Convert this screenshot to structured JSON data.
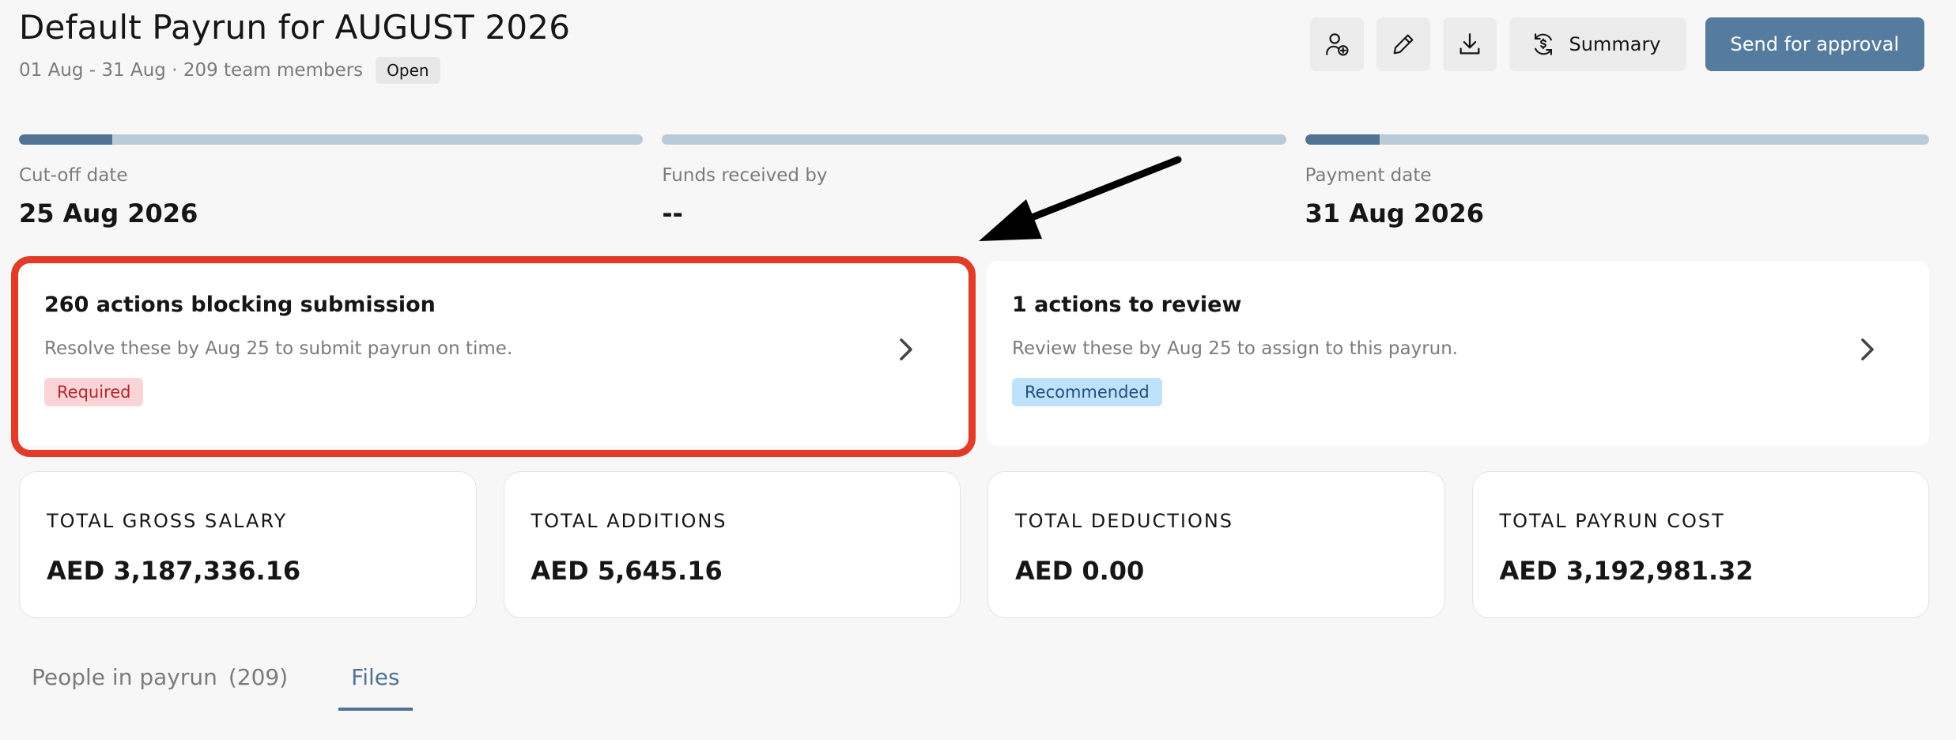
{
  "header": {
    "title": "Default Payrun for AUGUST 2026",
    "meta": "01 Aug - 31 Aug · 209 team members",
    "status": "Open"
  },
  "toolbar": {
    "icons": [
      "add-person-icon",
      "pencil-icon",
      "download-icon",
      "summary-icon"
    ],
    "summary_label": "Summary",
    "approval_label": "Send for approval",
    "accent_color": "#557c9e"
  },
  "steps": [
    {
      "label": "Cut-off date",
      "value": "25 Aug 2026",
      "progress": 0.15
    },
    {
      "label": "Funds received by",
      "value": "--",
      "progress": 0
    },
    {
      "label": "Payment date",
      "value": "31 Aug 2026",
      "progress": 0.12
    }
  ],
  "actions": [
    {
      "title": "260 actions blocking submission",
      "description": "Resolve these by Aug 25 to submit payrun on time.",
      "tag": "Required"
    },
    {
      "title": "1 actions to review",
      "description": "Review these by Aug 25 to assign to this payrun.",
      "tag": "Recommended"
    }
  ],
  "totals": [
    {
      "label": "TOTAL GROSS SALARY",
      "value": "AED 3,187,336.16"
    },
    {
      "label": "TOTAL ADDITIONS",
      "value": "AED 5,645.16"
    },
    {
      "label": "TOTAL DEDUCTIONS",
      "value": "AED 0.00"
    },
    {
      "label": "TOTAL PAYRUN COST",
      "value": "AED 3,192,981.32"
    }
  ],
  "tabs": [
    {
      "label": "People in payrun",
      "count": "(209)"
    },
    {
      "label": "Files"
    }
  ],
  "annotation_color": "#e23c28"
}
